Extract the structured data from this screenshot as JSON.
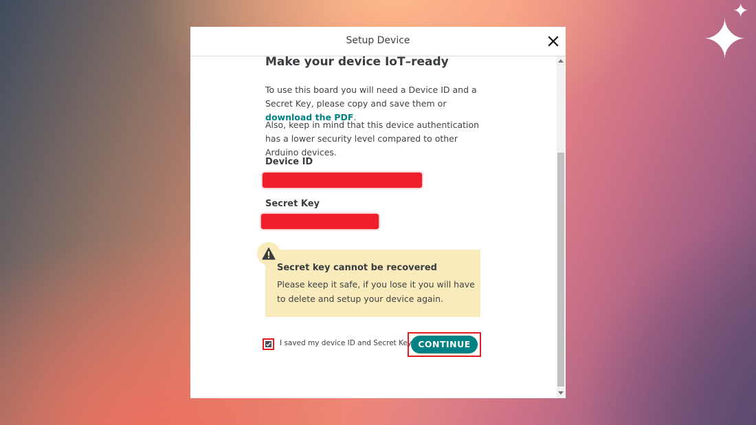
{
  "dialog": {
    "title": "Setup Device",
    "close_icon": "close-icon"
  },
  "content": {
    "heading": "Make your device IoT–ready",
    "intro_text": "To use this board you will need a Device ID and a Secret Key, please copy and save them or ",
    "pdf_link": "download the PDF",
    "intro_end": ".",
    "note_text": "Also, keep in mind that this device authentication has a lower security level compared to other Arduino devices.",
    "device_id_label": "Device ID",
    "secret_key_label": "Secret Key"
  },
  "warning": {
    "icon": "warning-triangle-icon",
    "title": "Secret key cannot be recovered",
    "text": "Please keep it safe, if you lose it you will have to delete and setup your device again."
  },
  "confirm": {
    "checkbox_checked": true,
    "checkbox_label": "I saved my device ID and Secret Key",
    "continue_label": "CONTINUE"
  },
  "colors": {
    "accent": "#008184",
    "highlight_red": "#e31b23",
    "warning_bg": "#f9ebbb"
  }
}
